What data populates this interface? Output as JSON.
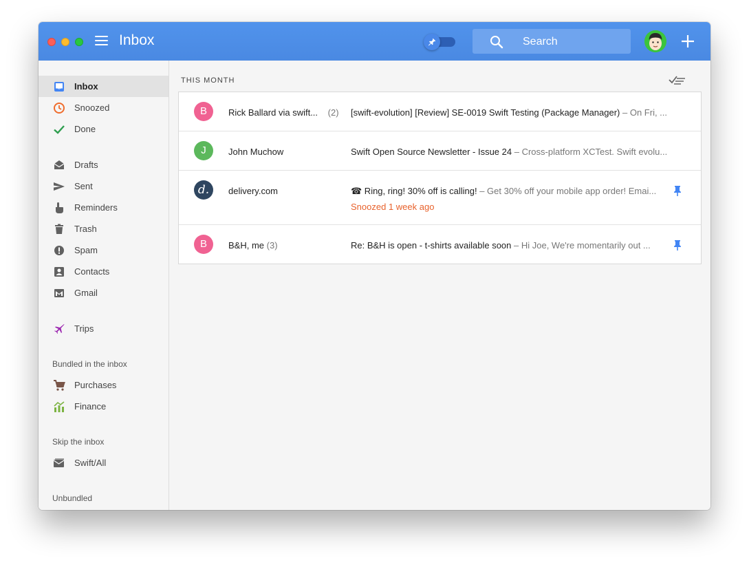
{
  "window": {
    "title": "Inbox"
  },
  "search": {
    "placeholder": "Search"
  },
  "sidebar": {
    "items": [
      {
        "label": "Inbox",
        "icon": "inbox-icon",
        "active": true
      },
      {
        "label": "Snoozed",
        "icon": "clock-icon"
      },
      {
        "label": "Done",
        "icon": "check-icon"
      },
      {
        "label": "Drafts",
        "icon": "drafts-icon"
      },
      {
        "label": "Sent",
        "icon": "send-icon"
      },
      {
        "label": "Reminders",
        "icon": "reminder-hand-icon"
      },
      {
        "label": "Trash",
        "icon": "trash-icon"
      },
      {
        "label": "Spam",
        "icon": "spam-icon"
      },
      {
        "label": "Contacts",
        "icon": "contacts-icon"
      },
      {
        "label": "Gmail",
        "icon": "gmail-icon"
      },
      {
        "label": "Trips",
        "icon": "airplane-icon"
      }
    ],
    "bundled_heading": "Bundled in the inbox",
    "bundled": [
      {
        "label": "Purchases",
        "icon": "cart-icon"
      },
      {
        "label": "Finance",
        "icon": "finance-chart-icon"
      }
    ],
    "skip_heading": "Skip the inbox",
    "skip": [
      {
        "label": "Swift/All",
        "icon": "label-mail-icon"
      }
    ],
    "unbundled_heading": "Unbundled"
  },
  "main": {
    "section_label": "THIS MONTH",
    "emails": [
      {
        "avatar_letter": "B",
        "avatar_color": "#f06292",
        "sender": "Rick Ballard via swift...",
        "count": "(2)",
        "subject": "[swift-evolution] [Review] SE-0019 Swift Testing (Package Manager)",
        "snippet": " – On Fri, ...",
        "pinned": false
      },
      {
        "avatar_letter": "J",
        "avatar_color": "#5cb85c",
        "sender": "John Muchow",
        "count": "",
        "subject": "Swift Open Source Newsletter - Issue 24",
        "snippet": " – Cross-platform XCTest. Swift evolu...",
        "pinned": false
      },
      {
        "avatar_letter": "d.",
        "avatar_color": "#2f4660",
        "sender": "delivery.com",
        "count": "",
        "subject": "☎ Ring, ring! 30% off is calling!",
        "snippet": " – Get 30% off your mobile app order! Emai...",
        "snoozed": "Snoozed 1 week ago",
        "pinned": true
      },
      {
        "avatar_letter": "B",
        "avatar_color": "#f06292",
        "sender": "B&H, me",
        "count": "(3)",
        "subject": "Re: B&H is open - t-shirts available soon",
        "snippet": " – Hi Joe, We're momentarily out ...",
        "pinned": true
      }
    ]
  },
  "colors": {
    "titlebar": "#4c8ce8",
    "accent_pin": "#4285f4",
    "snooze": "#e8622c"
  }
}
